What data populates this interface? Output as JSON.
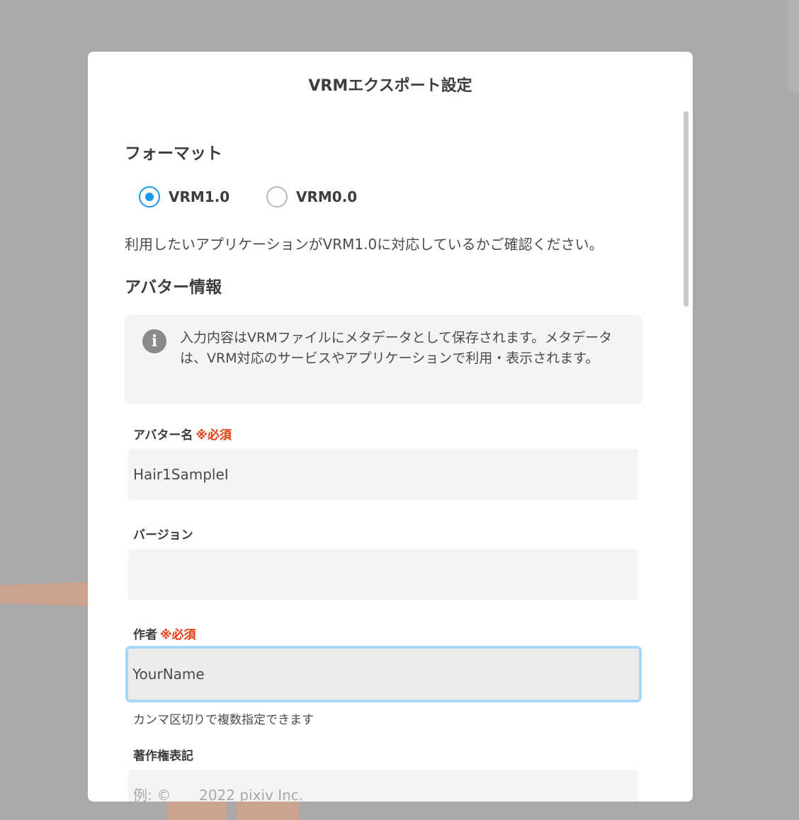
{
  "modal": {
    "title": "VRMエクスポート設定"
  },
  "format": {
    "heading": "フォーマット",
    "options": [
      {
        "label": "VRM1.0",
        "selected": true
      },
      {
        "label": "VRM0.0",
        "selected": false
      }
    ],
    "note": "利用したいアプリケーションがVRM1.0に対応しているかご確認ください。"
  },
  "avatar_info": {
    "heading": "アバター情報",
    "info_text": "入力内容はVRMファイルにメタデータとして保存されます。メタデータは、VRM対応のサービスやアプリケーションで利用・表示されます。"
  },
  "fields": {
    "avatar_name": {
      "label": "アバター名",
      "required": "※必須",
      "value": "Hair1SampleI"
    },
    "version": {
      "label": "バージョン",
      "value": ""
    },
    "author": {
      "label": "作者",
      "required": "※必須",
      "value": "YourName",
      "hint": "カンマ区切りで複数指定できます"
    },
    "copyright": {
      "label": "著作権表記",
      "placeholder": "例: ©　　2022 pixiv Inc.",
      "value": ""
    }
  },
  "colors": {
    "accent": "#1d97ea",
    "required": "#e8380d",
    "focus_ring": "#a9d8f6",
    "backdrop": "#a9a9a9"
  },
  "icons": [
    "radio-checked-icon",
    "radio-unchecked-icon",
    "info-icon"
  ]
}
